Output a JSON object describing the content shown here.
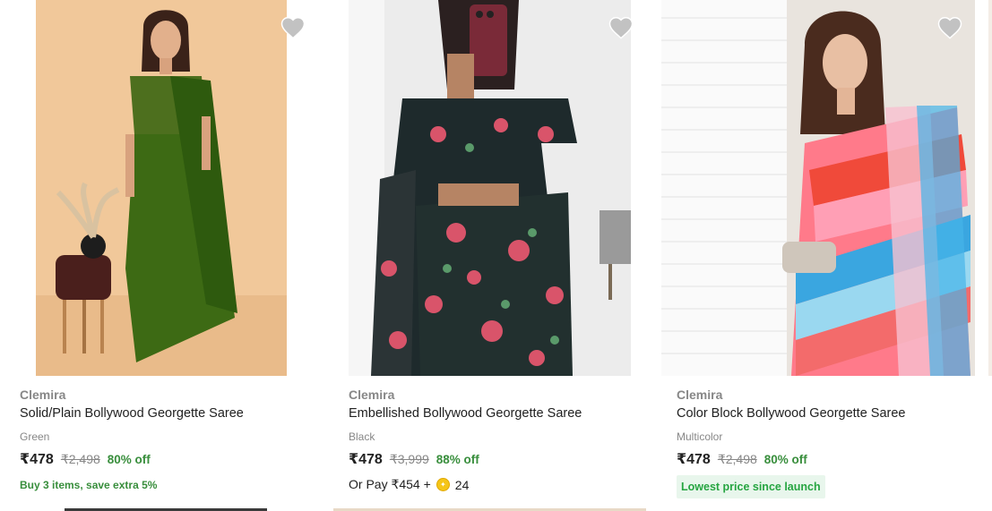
{
  "products": [
    {
      "brand": "Clemira",
      "title": "Solid/Plain Bollywood Georgette Saree",
      "color": "Green",
      "price": "₹478",
      "mrp": "₹2,498",
      "discount": "80% off",
      "offer": "Buy 3 items, save extra 5%"
    },
    {
      "brand": "Clemira",
      "title": "Embellished Bollywood Georgette Saree",
      "color": "Black",
      "price": "₹478",
      "mrp": "₹3,999",
      "discount": "88% off",
      "or_pay_label": "Or Pay ₹454 +",
      "coin_icon": "supercoin-icon",
      "coins": "24"
    },
    {
      "brand": "Clemira",
      "title": "Color Block Bollywood Georgette Saree",
      "color": "Multicolor",
      "price": "₹478",
      "mrp": "₹2,498",
      "discount": "80% off",
      "badge": "Lowest price since launch"
    }
  ],
  "icons": {
    "wishlist": "heart-icon"
  },
  "colors": {
    "discount_green": "#388e3c",
    "badge_bg": "#e8f6ec",
    "muted": "#878787",
    "heart": "#c2c2c2"
  }
}
